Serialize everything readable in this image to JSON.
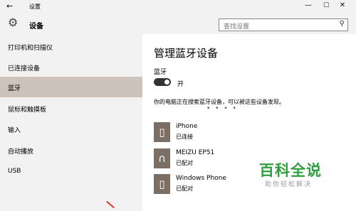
{
  "window": {
    "back_icon": "back-arrow-icon",
    "title": "设置",
    "controls": {
      "minimize": "—",
      "maximize": "☐",
      "close": "✕"
    }
  },
  "header": {
    "icon": "gear-icon",
    "app_name": "设备",
    "search_placeholder": "查找设置",
    "search_icon": "search-icon"
  },
  "sidebar": {
    "items": [
      {
        "label": "打印机和扫描仪",
        "selected": false
      },
      {
        "label": "已连接设备",
        "selected": false
      },
      {
        "label": "蓝牙",
        "selected": true
      },
      {
        "label": "鼠标和触摸板",
        "selected": false
      },
      {
        "label": "输入",
        "selected": false
      },
      {
        "label": "自动播放",
        "selected": false
      },
      {
        "label": "USB",
        "selected": false
      }
    ]
  },
  "main": {
    "title": "管理蓝牙设备",
    "bluetooth_label": "蓝牙",
    "toggle_state": "开",
    "search_status": "你的电脑正在搜索蓝牙设备，可以被这些设备发现。",
    "progress_dots": "•   •  • •",
    "devices": [
      {
        "name": "iPhone",
        "status": "已连接",
        "icon": "phone-icon"
      },
      {
        "name": "MEIZU EP51",
        "status": "已配对",
        "icon": "headset-icon"
      },
      {
        "name": "Windows Phone",
        "status": "已配对",
        "icon": "phone-icon"
      }
    ]
  },
  "watermark": {
    "title": "百科全说",
    "subtitle": "助你轻松解决"
  },
  "colors": {
    "selected_bg": "#cdc3bb",
    "icon_tile": "#7a6e65",
    "toggle_on": "#333333",
    "watermark_green": "#2f9e3f",
    "accent_edge": "#63b32f"
  }
}
